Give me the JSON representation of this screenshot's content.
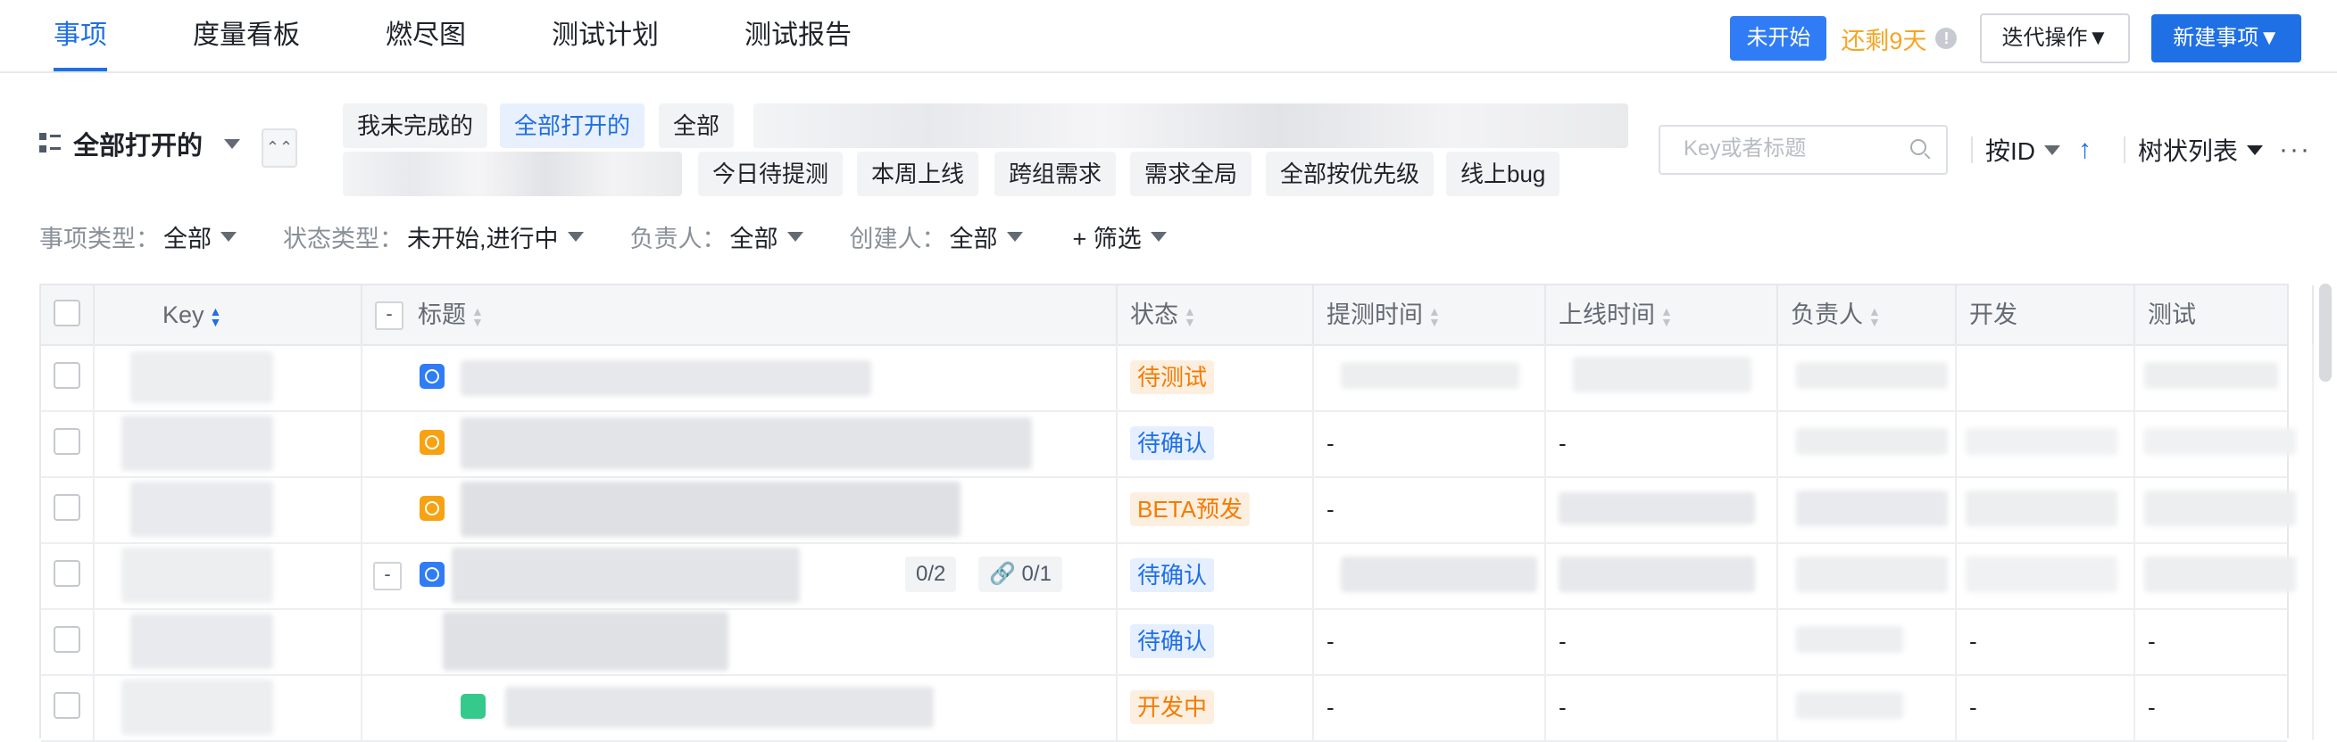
{
  "tabs": [
    {
      "label": "事项",
      "active": true
    },
    {
      "label": "度量看板"
    },
    {
      "label": "燃尽图"
    },
    {
      "label": "测试计划"
    },
    {
      "label": "测试报告"
    }
  ],
  "header": {
    "status": "未开始",
    "remaining": "还剩9天",
    "iteration_ops": "迭代操作▼",
    "new_item": "新建事项▼"
  },
  "view": {
    "title": "全部打开的"
  },
  "chips": [
    "我未完成的",
    "全部打开的",
    "全部",
    "今日待提测",
    "本周上线",
    "跨组需求",
    "需求全局",
    "全部按优先级",
    "线上bug"
  ],
  "search": {
    "placeholder": "Key或者标题"
  },
  "sort": {
    "by": "按ID",
    "tree": "树状列表"
  },
  "filters": [
    {
      "label": "事项类型：",
      "value": "全部"
    },
    {
      "label": "状态类型：",
      "value": "未开始,进行中"
    },
    {
      "label": "负责人：",
      "value": "全部"
    },
    {
      "label": "创建人：",
      "value": "全部"
    },
    {
      "label": "",
      "value": "+ 筛选"
    }
  ],
  "table": {
    "headers": [
      "Key",
      "标题",
      "状态",
      "提测时间",
      "上线时间",
      "负责人",
      "开发",
      "测试"
    ],
    "rows": [
      {
        "status": "待测试",
        "status_color": "orange",
        "test_time": "",
        "online_time": "",
        "dev": "",
        "qa": ""
      },
      {
        "status": "待确认",
        "status_color": "blue",
        "test_time": "-",
        "online_time": "-",
        "dev": "",
        "qa": ""
      },
      {
        "status": "BETA预发",
        "status_color": "orange",
        "test_time": "-",
        "online_time": "",
        "dev": "",
        "qa": ""
      },
      {
        "status": "待确认",
        "status_color": "blue",
        "test_time": "",
        "online_time": "",
        "dev": "",
        "qa": "",
        "subtasks": "0/2",
        "links": "🔗 0/1"
      },
      {
        "status": "待确认",
        "status_color": "blue",
        "test_time": "-",
        "online_time": "-",
        "dev": "-",
        "qa": "-"
      },
      {
        "status": "开发中",
        "status_color": "orange",
        "test_time": "-",
        "online_time": "-",
        "dev": "-",
        "qa": "-"
      }
    ]
  },
  "colors": {
    "accent": "#1f6fe5",
    "warning": "#f5a623",
    "status_orange": "#f57b00"
  },
  "icons": [
    "list-view-icon",
    "collapse-icon",
    "search-icon",
    "sort-asc-icon",
    "more-icon",
    "info-icon",
    "link-icon"
  ]
}
